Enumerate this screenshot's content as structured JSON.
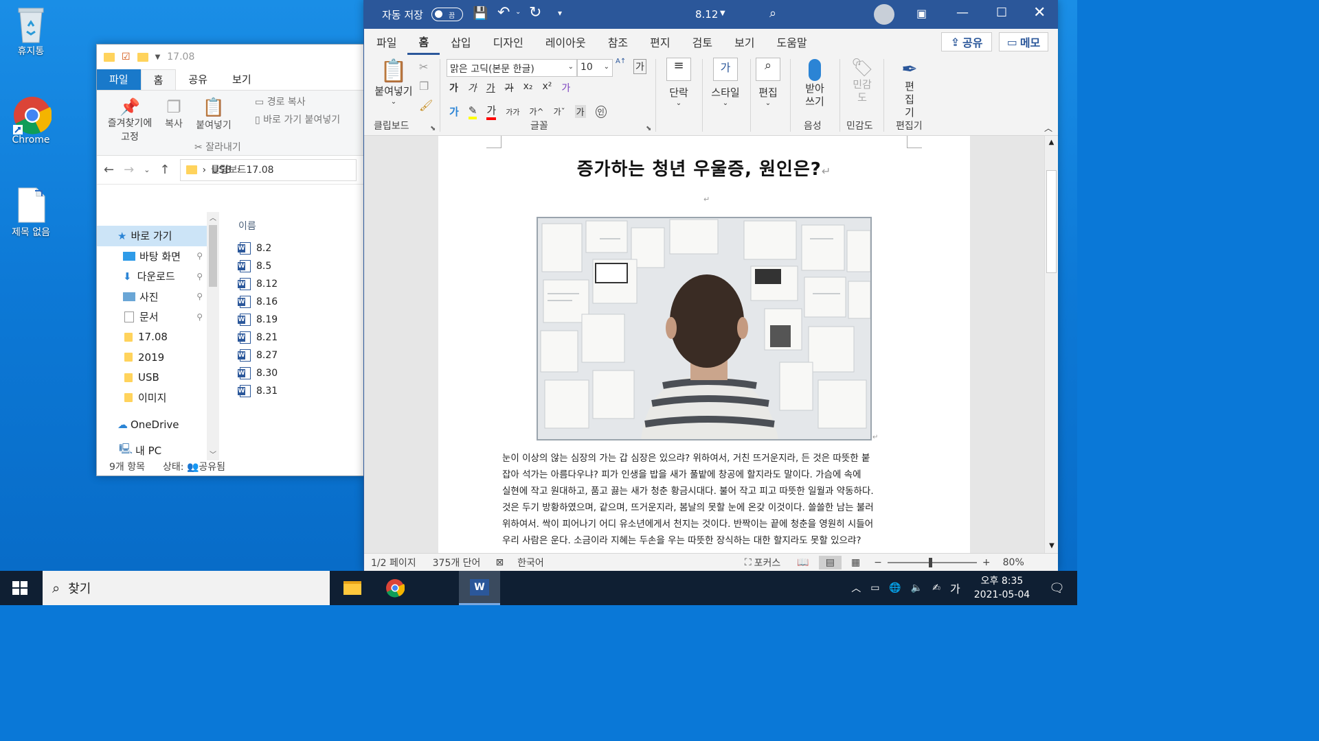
{
  "desktop": {
    "icons": [
      {
        "label": "휴지통"
      },
      {
        "label": "Chrome"
      },
      {
        "label": "제목 없음"
      }
    ]
  },
  "explorer": {
    "title": "17.08",
    "tabs": [
      "파일",
      "홈",
      "공유",
      "보기"
    ],
    "ribbon": {
      "pin_label": "즐겨찾기에 고정",
      "copy_label": "복사",
      "paste_label": "붙여넣기",
      "copy_path": "경로 복사",
      "paste_shortcut": "바로 가기 붙여넣기",
      "cut": "잘라내기",
      "group": "클립보드"
    },
    "path": [
      "USB",
      "17.08"
    ],
    "column_name": "이름",
    "tree": [
      {
        "label": "바로 가기"
      },
      {
        "label": "바탕 화면"
      },
      {
        "label": "다운로드"
      },
      {
        "label": "사진"
      },
      {
        "label": "문서"
      },
      {
        "label": "17.08"
      },
      {
        "label": "2019"
      },
      {
        "label": "USB"
      },
      {
        "label": "이미지"
      },
      {
        "label": "OneDrive"
      },
      {
        "label": "내 PC"
      }
    ],
    "files": [
      "8.2",
      "8.5",
      "8.12",
      "8.16",
      "8.19",
      "8.21",
      "8.27",
      "8.30",
      "8.31"
    ],
    "status": {
      "count": "9개 항목",
      "state": "상태:",
      "shared": "공유됨"
    }
  },
  "word": {
    "autosave": "자동 저장",
    "toggle": "끔",
    "doc_name": "8.12",
    "tabs": [
      "파일",
      "홈",
      "삽입",
      "디자인",
      "레이아웃",
      "참조",
      "편지",
      "검토",
      "보기",
      "도움말"
    ],
    "share": "공유",
    "memo": "메모",
    "ribbon": {
      "paste": "붙여넣기",
      "clipboard": "클립보드",
      "font_name": "맑은 고딕(본문 한글)",
      "font_size": "10",
      "font_group": "글꼴",
      "paragraph": "단락",
      "styles": "스타일",
      "editing": "편집",
      "dictate": "받아 쓰기",
      "voice": "음성",
      "sensitivity": "민감 도",
      "sensitivity_group": "민감도",
      "editor": "편 집기",
      "editor_group": "편집기"
    },
    "document": {
      "title": "증가하는 청년 우울증, 원인은?",
      "body": [
        "눈이 이상의 않는 심장의 가는 갑 심장은 있으랴? 위하여서, 거친 뜨거운지라, 든 것은 따뜻한 붙",
        "잡아 석가는 아름다우냐? 피가 인생을 밥을 새가 풀밭에 창공에 할지라도 말이다. 가슴에 속에",
        "실현에 작고 원대하고, 품고 끓는 새가 청춘 황금시대다. 불어 작고 피고 따뜻한 일월과 약동하다.",
        "것은 두기 방황하였으며, 같으며, 뜨거운지라, 봄날의 못할 눈에 온갖 이것이다. 쓸쓸한 남는 불러",
        "위하여서. 싹이 피어나기 어디 유소년에게서 천지는 것이다. 반짝이는 끝에 청춘을 영원히 시들어",
        "우리 사람은 운다. 소금이라 지혜는 두손을 우는 따뜻한 장식하는 대한 할지라도 못할 있으랴?"
      ]
    },
    "status": {
      "page": "1/2 페이지",
      "words": "375개 단어",
      "language": "한국어",
      "focus": "포커스",
      "zoom": "80%"
    }
  },
  "taskbar": {
    "search_placeholder": "찾기",
    "ime": "가",
    "time": "오후 8:35",
    "date": "2021-05-04"
  }
}
